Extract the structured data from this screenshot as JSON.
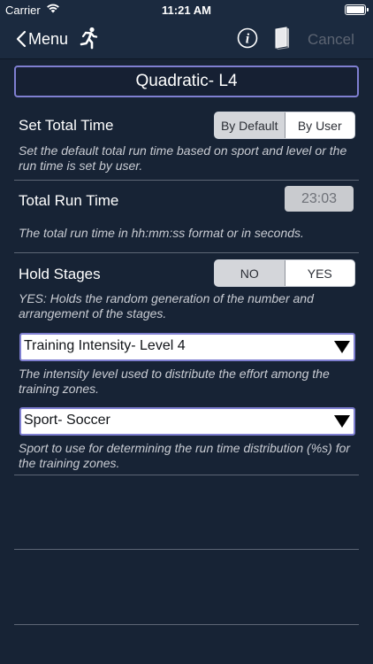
{
  "status_bar": {
    "carrier": "Carrier",
    "time": "11:21 AM"
  },
  "nav": {
    "back_label": "Menu",
    "cancel_label": "Cancel",
    "icons": [
      "runner-icon",
      "info-icon",
      "book-icon"
    ]
  },
  "title": "Quadratic- L4",
  "total_time": {
    "label": "Set Total Time",
    "options": [
      "By Default",
      "By User"
    ],
    "selected": "By Default",
    "help": "Set the default total run time based on sport and level or the run time is set by user."
  },
  "run_time": {
    "label": "Total Run Time",
    "value": "23:03",
    "help": "The total run time in hh:mm:ss format or in seconds."
  },
  "hold_stages": {
    "label": "Hold Stages",
    "options": [
      "NO",
      "YES"
    ],
    "selected": "NO",
    "help": "YES: Holds the random generation of the number and arrangement of the stages."
  },
  "intensity": {
    "value": "Training Intensity- Level 4",
    "help": "The intensity level used to distribute the effort among the training zones."
  },
  "sport": {
    "value": "Sport- Soccer",
    "help": "Sport to use for determining the run time distribution (%s) for the training zones."
  },
  "colors": {
    "background": "#172335",
    "accent_border": "#7f7fd1",
    "divider": "#5d6675",
    "disabled": "#5c6472"
  }
}
